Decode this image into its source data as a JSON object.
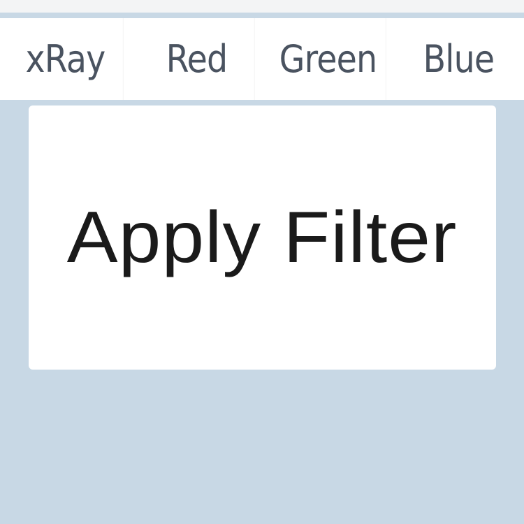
{
  "filters": {
    "tabs": [
      {
        "label": "xRay"
      },
      {
        "label": "Red"
      },
      {
        "label": "Green"
      },
      {
        "label": "Blue"
      }
    ]
  },
  "action": {
    "apply_label": "Apply Filter"
  },
  "colors": {
    "background": "#c8d8e5",
    "panel": "#ffffff",
    "tab_text": "#4a5360",
    "button_text": "#1a1a1a"
  }
}
